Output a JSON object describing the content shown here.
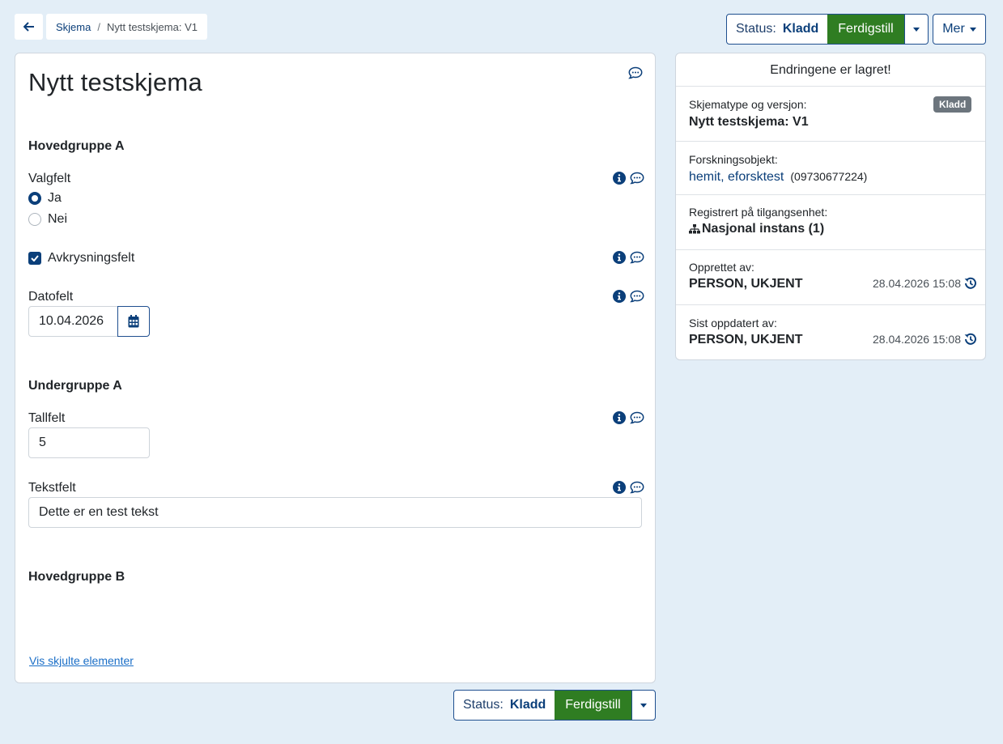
{
  "breadcrumb": {
    "parent": "Skjema",
    "separator": "/",
    "current": "Nytt testskjema: V1"
  },
  "status_bar": {
    "status_label": "Status:",
    "status_value": "Kladd",
    "finish_label": "Ferdigstill",
    "more_label": "Mer"
  },
  "form": {
    "title": "Nytt testskjema",
    "group_a": "Hovedgruppe A",
    "choice_label": "Valgfelt",
    "choice_options": [
      "Ja",
      "Nei"
    ],
    "checkbox_label": "Avkrysningsfelt",
    "date_label": "Datofelt",
    "date_value": "10.04.2026",
    "subgroup_a": "Undergruppe A",
    "number_label": "Tallfelt",
    "number_value": "5",
    "text_label": "Tekstfelt",
    "text_value": "Dette er en test tekst",
    "group_b": "Hovedgruppe B",
    "show_hidden_link": "Vis skjulte elementer"
  },
  "side": {
    "saved_msg": "Endringene er lagret!",
    "schema_type_label": "Skjematype og versjon:",
    "schema_type_value": "Nytt testskjema: V1",
    "badge": "Kladd",
    "research_object_label": "Forskningsobjekt:",
    "research_object_link": "hemit, eforsktest",
    "research_object_id": "(09730677224)",
    "registered_label": "Registrert på tilgangsenhet:",
    "registered_value": "Nasjonal instans (1)",
    "created_label": "Opprettet av:",
    "created_by": "PERSON, UKJENT",
    "created_time": "28.04.2026 15:08",
    "updated_label": "Sist oppdatert av:",
    "updated_by": "PERSON, UKJENT",
    "updated_time": "28.04.2026 15:08"
  },
  "colors": {
    "primary": "#0b3f7a",
    "success": "#2f7d22",
    "background": "#e3eef7"
  }
}
